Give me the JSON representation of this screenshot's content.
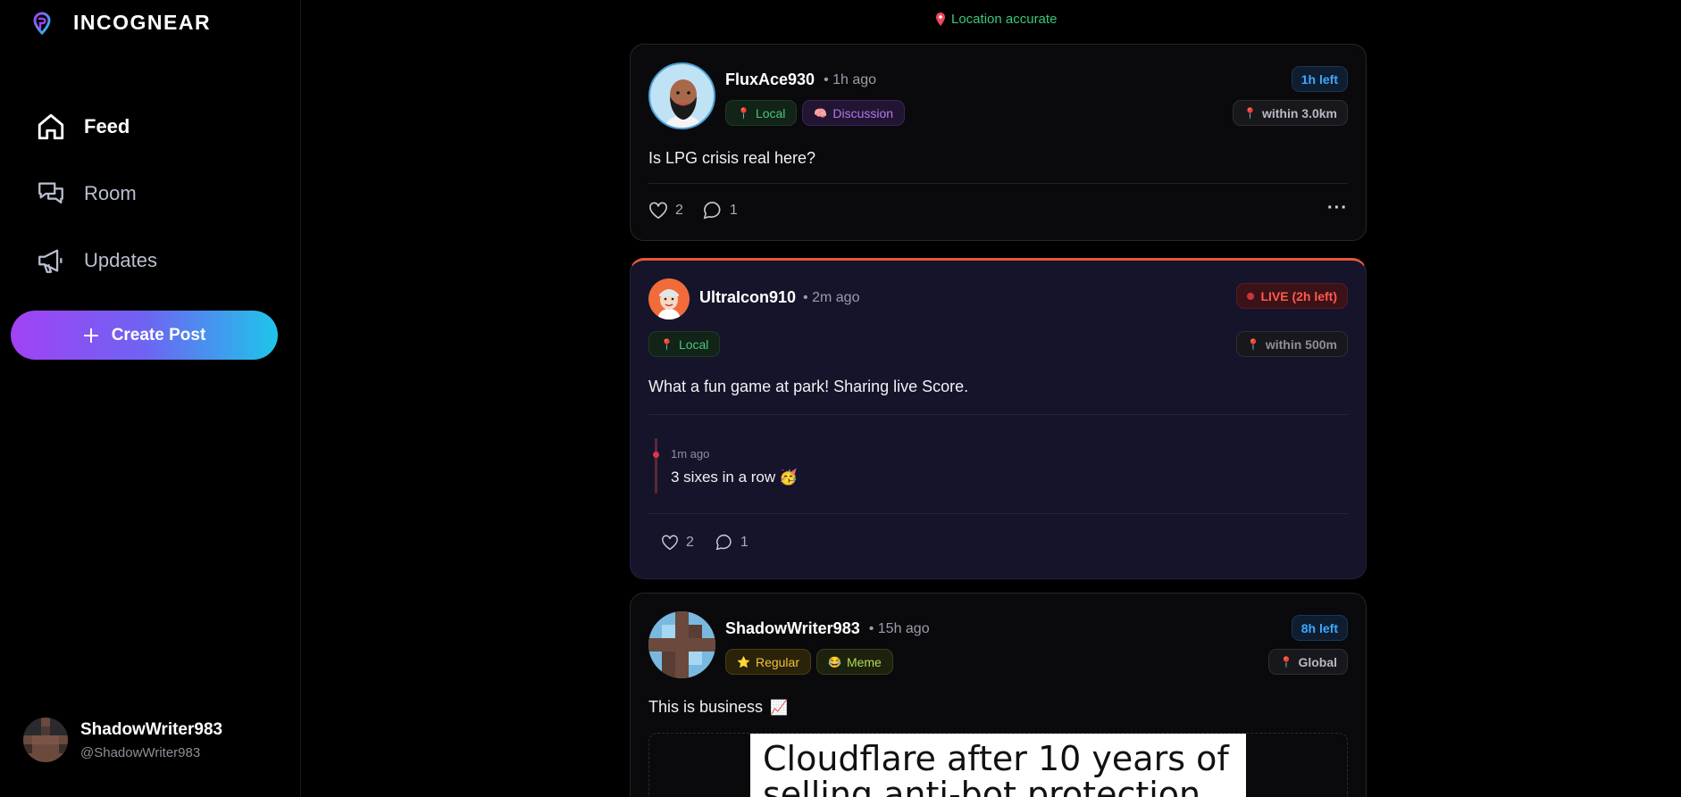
{
  "app": {
    "title": "INCOGNEAR"
  },
  "sidebar": {
    "nav": [
      {
        "label": "Feed",
        "icon": "home-icon",
        "active": true
      },
      {
        "label": "Room",
        "icon": "chat-bubbles-icon",
        "active": false
      },
      {
        "label": "Updates",
        "icon": "megaphone-icon",
        "active": false
      }
    ],
    "create_label": "Create Post",
    "profile": {
      "name": "ShadowWriter983",
      "handle": "@ShadowWriter983"
    }
  },
  "feed": {
    "location_status": "Location accurate",
    "posts": [
      {
        "user": "FluxAce930",
        "time": "• 1h ago",
        "expiry": "1h left",
        "tags": [
          "Local",
          "Discussion"
        ],
        "distance": "within 3.0km",
        "text": "Is LPG crisis real here?",
        "likes": "2",
        "comments": "1"
      },
      {
        "user": "UltraIcon910",
        "time": "• 2m ago",
        "live_label": "LIVE (2h left)",
        "tags": [
          "Local"
        ],
        "distance": "within 500m",
        "text": "What a fun game at park! Sharing live Score.",
        "update": {
          "time": "1m ago",
          "text": "3 sixes in a row"
        },
        "likes": "2",
        "comments": "1"
      },
      {
        "user": "ShadowWriter983",
        "time": "• 15h ago",
        "expiry": "8h left",
        "tags": [
          "Regular",
          "Meme"
        ],
        "distance": "Global",
        "text": "This is business",
        "image_caption_line1": "Cloudflare after 10 years of",
        "image_caption_line2": "selling anti-bot protection"
      }
    ]
  },
  "colors": {
    "accent_purple": "#a142f4",
    "accent_cyan": "#1ec5ea",
    "live_red": "#ff5a4e",
    "local_green": "#45c77c"
  }
}
